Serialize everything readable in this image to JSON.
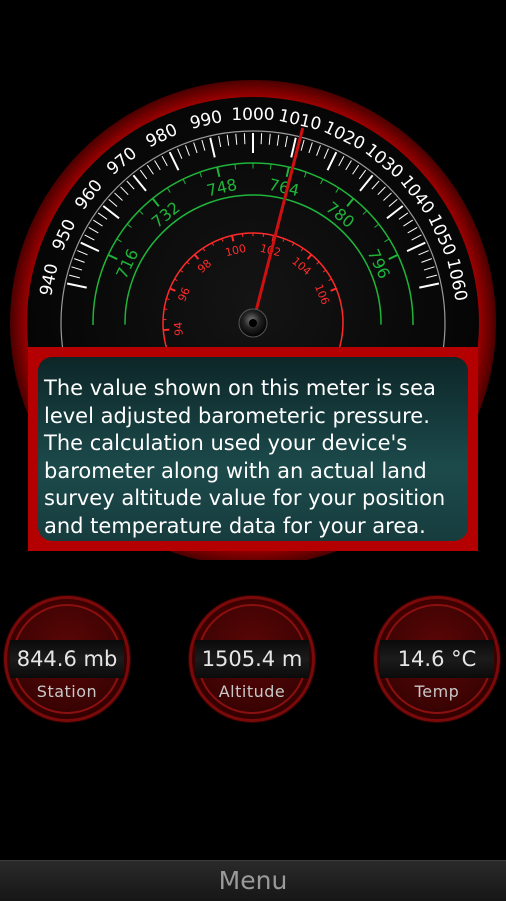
{
  "gauge": {
    "outer_scale_ticks": [
      940,
      950,
      960,
      970,
      980,
      990,
      1000,
      1010,
      1020,
      1030,
      1040,
      1050,
      1060
    ],
    "middle_scale_ticks": [
      716,
      732,
      748,
      764,
      780,
      796
    ],
    "inner_scale_ticks": [
      94,
      96,
      98,
      100,
      102,
      104,
      106
    ],
    "needle_value": 1011,
    "colors": {
      "outer_text": "#ffffff",
      "middle_text": "#1fb53a",
      "inner_text": "#ff2a2a",
      "needle": "#d01010",
      "bezel": "#a00000"
    }
  },
  "tooltip": {
    "text": "The value shown on this meter is sea level adjusted barometeric pressure. The calculation used your device's barometer along with an actual land survey altitude value for your position and temperature data for your area."
  },
  "readouts": [
    {
      "value": "844.6 mb",
      "label": "Station"
    },
    {
      "value": "1505.4 m",
      "label": "Altitude"
    },
    {
      "value": "14.6 °C",
      "label": "Temp"
    }
  ],
  "menu": {
    "label": "Menu"
  }
}
